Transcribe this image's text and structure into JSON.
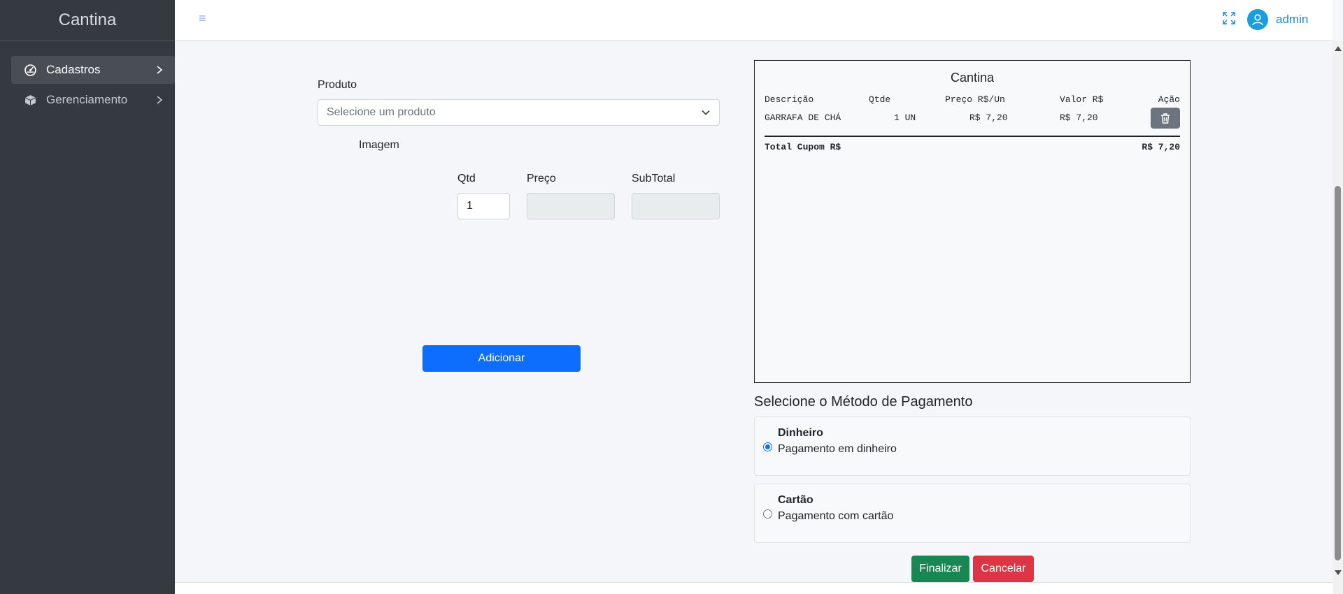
{
  "sidebar": {
    "brand": "Cantina",
    "items": [
      {
        "label": "Cadastros",
        "icon": "gauge-icon",
        "active": true
      },
      {
        "label": "Gerenciamento",
        "icon": "box-icon",
        "active": false
      }
    ]
  },
  "header": {
    "menu_icon": "hamburger-icon",
    "fullscreen_icon": "expand-icon",
    "user_icon": "user-avatar-icon",
    "username": "admin"
  },
  "form": {
    "produto_label": "Produto",
    "produto_placeholder": "Selecione um produto",
    "imagem_label": "Imagem",
    "qtd_label": "Qtd",
    "qtd_value": "1",
    "preco_label": "Preço",
    "preco_value": "",
    "subtotal_label": "SubTotal",
    "subtotal_value": "",
    "add_button": "Adicionar"
  },
  "receipt": {
    "title": "Cantina",
    "columns": [
      "Descrição",
      "Qtde",
      "Preço R$/Un",
      "Valor R$",
      "Ação"
    ],
    "rows": [
      {
        "descricao": "GARRAFA DE CHÁ",
        "qtde": "1 UN",
        "preco": "R$ 7,20",
        "valor": "R$ 7,20"
      }
    ],
    "total_label": "Total Cupom R$",
    "total_value": "R$ 7,20"
  },
  "payment": {
    "title": "Selecione o Método de Pagamento",
    "options": [
      {
        "name": "Dinheiro",
        "desc": "Pagamento em dinheiro",
        "checked": true
      },
      {
        "name": "Cartão",
        "desc": "Pagamento com cartão",
        "checked": false
      }
    ]
  },
  "actions": {
    "finalizar": "Finalizar",
    "cancelar": "Cancelar"
  },
  "colors": {
    "sidebar_bg": "#343a40",
    "primary": "#0d6efd",
    "success": "#198754",
    "danger": "#dc3545",
    "secondary": "#6c757d"
  }
}
